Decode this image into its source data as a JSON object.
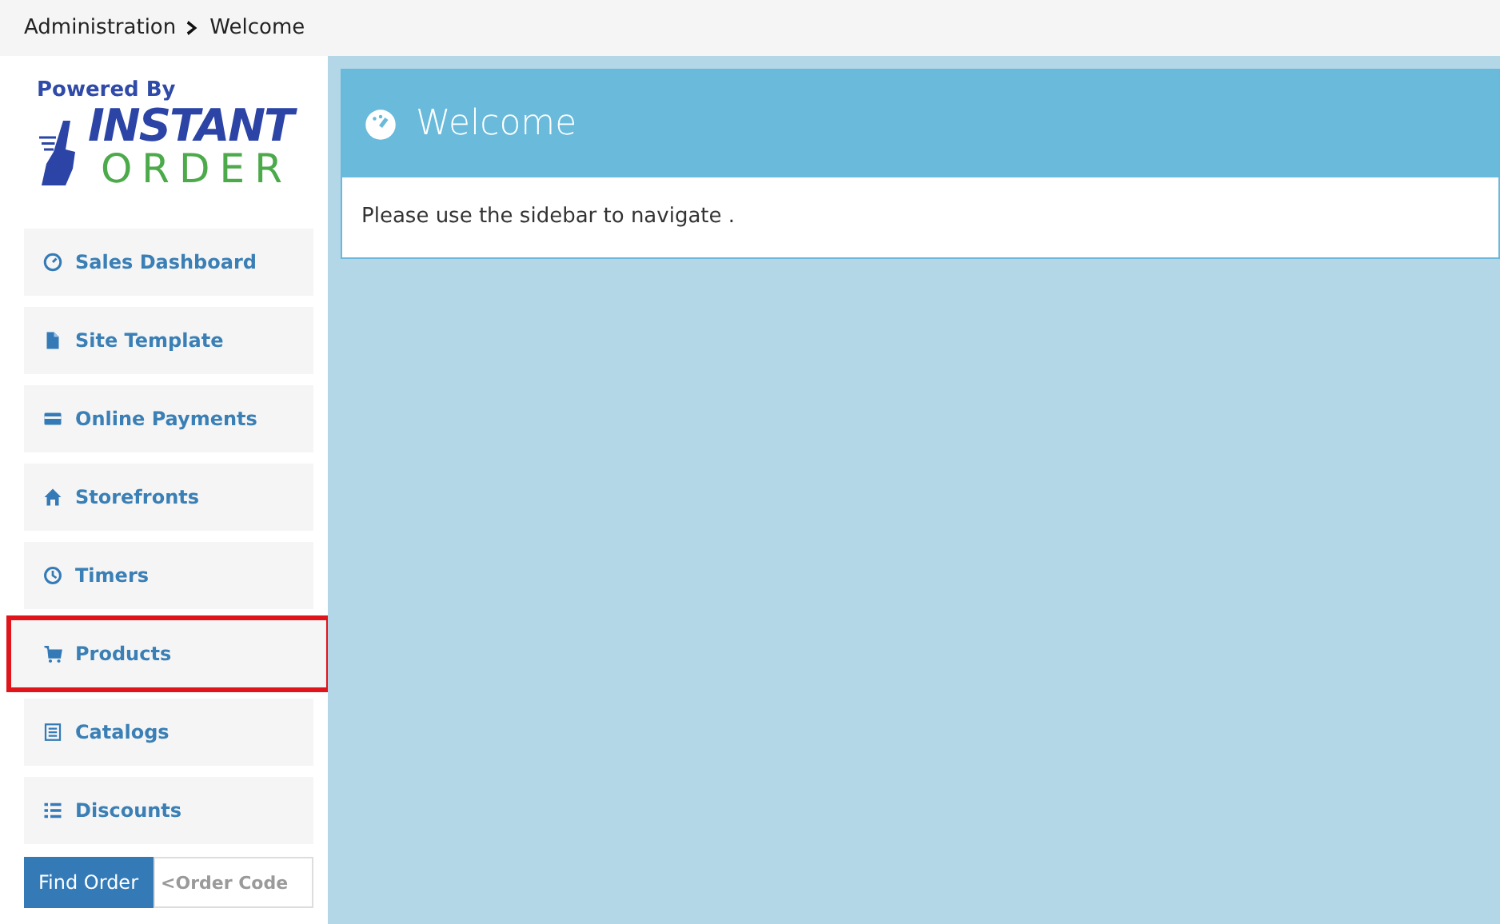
{
  "breadcrumb": [
    "Administration",
    "Welcome"
  ],
  "logo": {
    "tagline": "Powered By",
    "line_1": "INSTANT",
    "line_2": "ORDER"
  },
  "sidebar": {
    "items": [
      {
        "label": "Sales Dashboard",
        "kind": "dashboard",
        "highlighted": false
      },
      {
        "label": "Site Template",
        "kind": "file",
        "highlighted": false
      },
      {
        "label": "Online Payments",
        "kind": "card",
        "highlighted": false
      },
      {
        "label": "Storefronts",
        "kind": "home",
        "highlighted": false
      },
      {
        "label": "Timers",
        "kind": "clock",
        "highlighted": false
      },
      {
        "label": "Products",
        "kind": "cart",
        "highlighted": true
      },
      {
        "label": "Catalogs",
        "kind": "catalog",
        "highlighted": false
      },
      {
        "label": "Discounts",
        "kind": "list",
        "highlighted": false
      }
    ]
  },
  "find_order": {
    "button": "Find Order",
    "placeholder": "<Order Code"
  },
  "panel": {
    "title": "Welcome",
    "body": "Please use the sidebar to navigate ."
  }
}
